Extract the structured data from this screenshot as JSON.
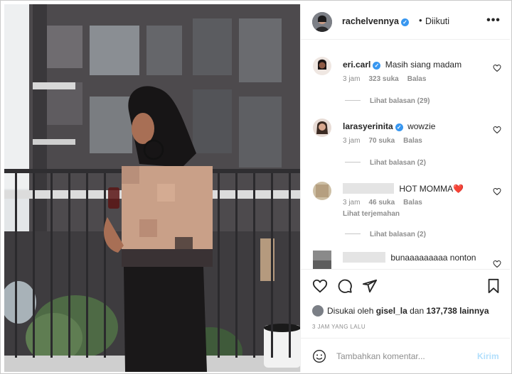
{
  "post": {
    "username": "rachelvennya",
    "separator": "•",
    "follow_status": "Diikuti",
    "more_label": "•••"
  },
  "comments": [
    {
      "username": "eri.carl",
      "verified": true,
      "text": "Masih siang madam",
      "time": "3 jam",
      "likes": "323 suka",
      "reply": "Balas",
      "view_replies": "Lihat balasan (29)"
    },
    {
      "username": "larasyerinita",
      "verified": true,
      "text": "wowzie",
      "time": "3 jam",
      "likes": "70 suka",
      "reply": "Balas",
      "view_replies": "Lihat balasan (2)"
    },
    {
      "username": "",
      "verified": false,
      "text": "HOT MOMMA❤️",
      "time": "3 jam",
      "likes": "46 suka",
      "reply": "Balas",
      "translate": "Lihat terjemahan",
      "view_replies": "Lihat balasan (2)"
    },
    {
      "username": "",
      "verified": false,
      "text": "bunaaaaaaaaa nonton"
    }
  ],
  "likes": {
    "prefix": "Disukai oleh",
    "user": "gisel_la",
    "middle": "dan",
    "count": "137,738 lainnya"
  },
  "time_ago": "3 JAM YANG LALU",
  "add_comment": {
    "placeholder": "Tambahkan komentar...",
    "send": "Kirim"
  },
  "icons": [
    "heart-icon",
    "comment-icon",
    "share-icon",
    "bookmark-icon",
    "emoji-icon",
    "more-icon"
  ],
  "colors": {
    "verified": "#3897f0",
    "send_disabled": "#b2dffc",
    "muted": "#8e8e8e",
    "heart_red": "#ed4956"
  }
}
